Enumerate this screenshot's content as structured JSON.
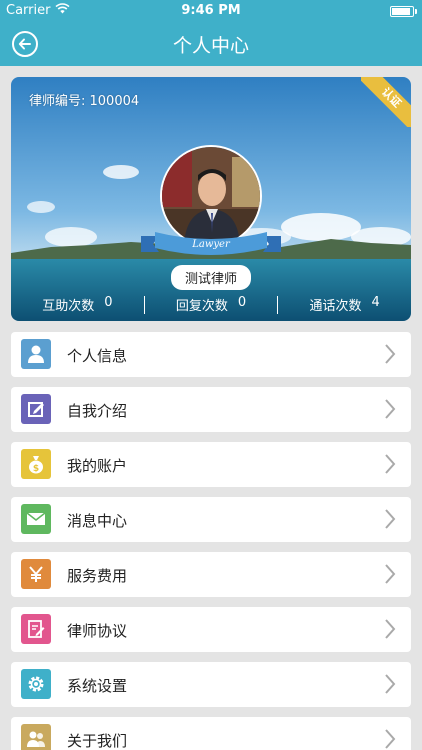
{
  "status": {
    "carrier": "Carrier",
    "time": "9:46 PM",
    "battery_level": 0.95
  },
  "header": {
    "title": "个人中心"
  },
  "profile": {
    "lawyer_id": "律师编号: 100004",
    "certified_label": "认证",
    "name": "测试律师",
    "ribbon_text": "Lawyer",
    "stats": [
      {
        "label": "互助次数",
        "value": "0"
      },
      {
        "label": "回复次数",
        "value": "0"
      },
      {
        "label": "通话次数",
        "value": "4"
      }
    ]
  },
  "menu": [
    {
      "label": "个人信息",
      "icon": "person-icon",
      "color": "#5b9fd0"
    },
    {
      "label": "自我介绍",
      "icon": "edit-icon",
      "color": "#6a63b8"
    },
    {
      "label": "我的账户",
      "icon": "money-bag-icon",
      "color": "#e6c43a"
    },
    {
      "label": "消息中心",
      "icon": "mail-icon",
      "color": "#5fb85f"
    },
    {
      "label": "服务费用",
      "icon": "yen-icon",
      "color": "#e08a3c"
    },
    {
      "label": "律师协议",
      "icon": "document-edit-icon",
      "color": "#e2568e"
    },
    {
      "label": "系统设置",
      "icon": "gear-icon",
      "color": "#3fb0c9"
    },
    {
      "label": "关于我们",
      "icon": "people-icon",
      "color": "#c9a95e"
    }
  ],
  "colors": {
    "accent": "#3fb0c9",
    "background": "#e4e4e4"
  }
}
